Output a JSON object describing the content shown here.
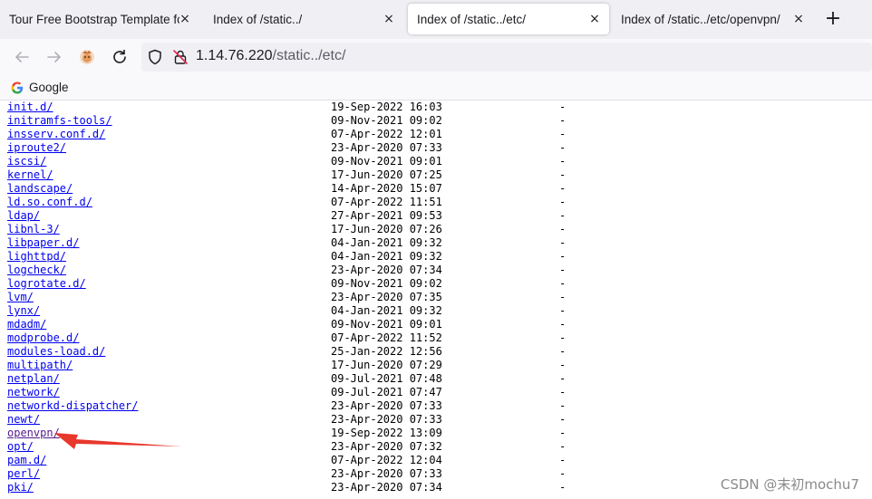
{
  "tabs": [
    {
      "label": "Tour Free Bootstrap Template for",
      "close": "×",
      "active": false
    },
    {
      "label": "Index of /static../",
      "close": "×",
      "active": false
    },
    {
      "label": "Index of /static../etc/",
      "close": "×",
      "active": true
    },
    {
      "label": "Index of /static../etc/openvpn/",
      "close": "×",
      "active": false
    }
  ],
  "new_tab": "+",
  "url": {
    "host": "1.14.76.220",
    "path": "/static../etc/"
  },
  "bookmarks": [
    {
      "label": "Google"
    }
  ],
  "listing": [
    {
      "name": "init.d/",
      "date": "19-Sep-2022 16:03",
      "size": "-"
    },
    {
      "name": "initramfs-tools/",
      "date": "09-Nov-2021 09:02",
      "size": "-"
    },
    {
      "name": "insserv.conf.d/",
      "date": "07-Apr-2022 12:01",
      "size": "-"
    },
    {
      "name": "iproute2/",
      "date": "23-Apr-2020 07:33",
      "size": "-"
    },
    {
      "name": "iscsi/",
      "date": "09-Nov-2021 09:01",
      "size": "-"
    },
    {
      "name": "kernel/",
      "date": "17-Jun-2020 07:25",
      "size": "-"
    },
    {
      "name": "landscape/",
      "date": "14-Apr-2020 15:07",
      "size": "-"
    },
    {
      "name": "ld.so.conf.d/",
      "date": "07-Apr-2022 11:51",
      "size": "-"
    },
    {
      "name": "ldap/",
      "date": "27-Apr-2021 09:53",
      "size": "-"
    },
    {
      "name": "libnl-3/",
      "date": "17-Jun-2020 07:26",
      "size": "-"
    },
    {
      "name": "libpaper.d/",
      "date": "04-Jan-2021 09:32",
      "size": "-"
    },
    {
      "name": "lighttpd/",
      "date": "04-Jan-2021 09:32",
      "size": "-"
    },
    {
      "name": "logcheck/",
      "date": "23-Apr-2020 07:34",
      "size": "-"
    },
    {
      "name": "logrotate.d/",
      "date": "09-Nov-2021 09:02",
      "size": "-"
    },
    {
      "name": "lvm/",
      "date": "23-Apr-2020 07:35",
      "size": "-"
    },
    {
      "name": "lynx/",
      "date": "04-Jan-2021 09:32",
      "size": "-"
    },
    {
      "name": "mdadm/",
      "date": "09-Nov-2021 09:01",
      "size": "-"
    },
    {
      "name": "modprobe.d/",
      "date": "07-Apr-2022 11:52",
      "size": "-"
    },
    {
      "name": "modules-load.d/",
      "date": "25-Jan-2022 12:56",
      "size": "-"
    },
    {
      "name": "multipath/",
      "date": "17-Jun-2020 07:29",
      "size": "-"
    },
    {
      "name": "netplan/",
      "date": "09-Jul-2021 07:48",
      "size": "-"
    },
    {
      "name": "network/",
      "date": "09-Jul-2021 07:47",
      "size": "-"
    },
    {
      "name": "networkd-dispatcher/",
      "date": "23-Apr-2020 07:33",
      "size": "-"
    },
    {
      "name": "newt/",
      "date": "23-Apr-2020 07:33",
      "size": "-"
    },
    {
      "name": "openvpn/",
      "date": "19-Sep-2022 13:09",
      "size": "-",
      "visited": true
    },
    {
      "name": "opt/",
      "date": "23-Apr-2020 07:32",
      "size": "-"
    },
    {
      "name": "pam.d/",
      "date": "07-Apr-2022 12:04",
      "size": "-"
    },
    {
      "name": "perl/",
      "date": "23-Apr-2020 07:33",
      "size": "-"
    },
    {
      "name": "pki/",
      "date": "23-Apr-2020 07:34",
      "size": "-"
    }
  ],
  "annotation_color": "#e8372c",
  "link_color": "#0000ee",
  "visited_color": "#551a8b",
  "watermark": "CSDN @末初mochu7"
}
